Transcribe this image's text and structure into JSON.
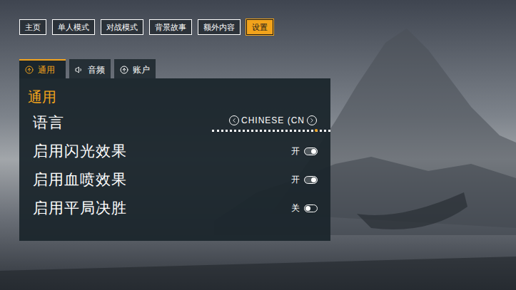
{
  "nav": [
    {
      "label": "主页",
      "selected": false
    },
    {
      "label": "单人模式",
      "selected": false
    },
    {
      "label": "对战模式",
      "selected": false
    },
    {
      "label": "背景故事",
      "selected": false
    },
    {
      "label": "额外内容",
      "selected": false
    },
    {
      "label": "设置",
      "selected": true
    }
  ],
  "tabs": [
    {
      "label": "通用",
      "selected": true
    },
    {
      "label": "音频",
      "selected": false
    },
    {
      "label": "账户",
      "selected": false
    }
  ],
  "panel": {
    "title": "通用"
  },
  "settings": [
    {
      "kind": "selector",
      "label": "语言",
      "value": "CHINESE (CN",
      "level": 0.87
    },
    {
      "kind": "toggle",
      "label": "启用闪光效果",
      "state_text": "开",
      "on": true
    },
    {
      "kind": "toggle",
      "label": "启用血喷效果",
      "state_text": "开",
      "on": true
    },
    {
      "kind": "toggle",
      "label": "启用平局决胜",
      "state_text": "关",
      "on": false
    }
  ]
}
